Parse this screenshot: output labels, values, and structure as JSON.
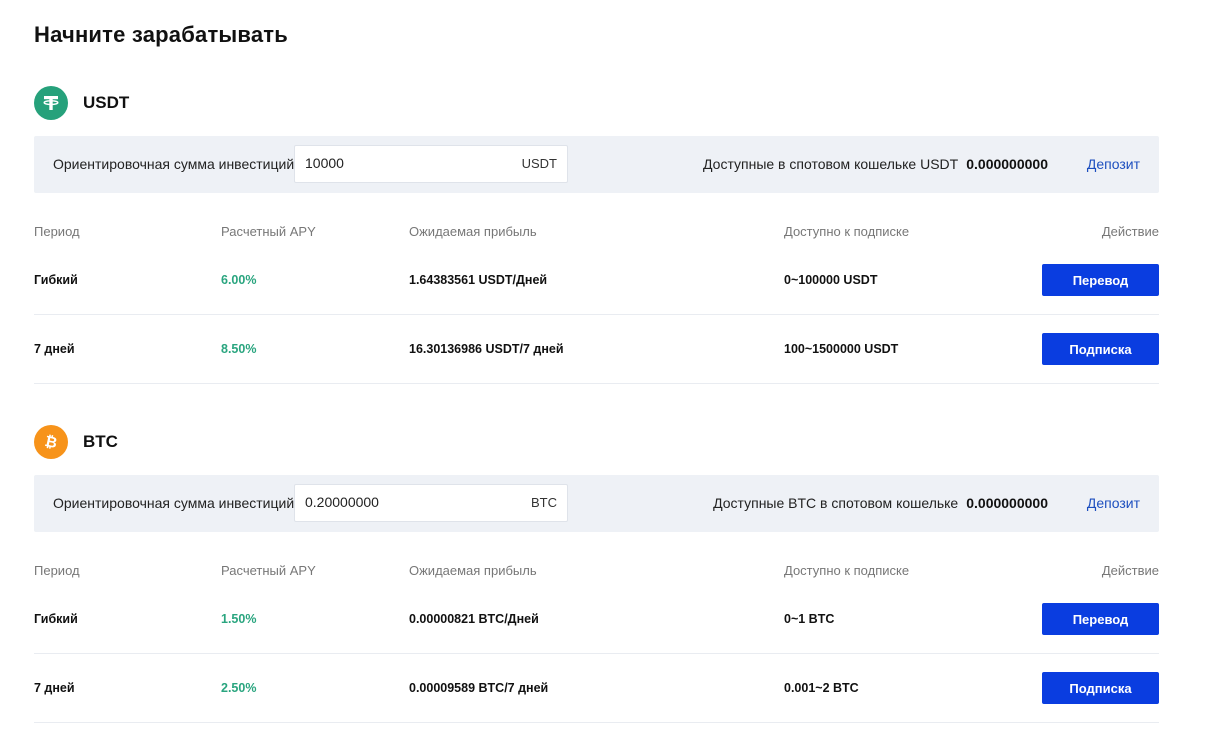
{
  "page": {
    "title": "Начните зарабатывать"
  },
  "columns": {
    "period": "Период",
    "apy": "Расчетный APY",
    "profit": "Ожидаемая прибыль",
    "available": "Доступно к подписке",
    "action": "Действие"
  },
  "invest_label": "Ориентировочная сумма инвестиций",
  "deposit_label": "Депозит",
  "sections": [
    {
      "coin": "USDT",
      "icon": "tether-icon",
      "icon_color": "#26a17b",
      "amount_value": "10000",
      "amount_unit": "USDT",
      "available_label": "Доступные в спотовом кошельке USDT",
      "balance": "0.000000000",
      "rows": [
        {
          "period": "Гибкий",
          "apy": "6.00%",
          "profit": "1.64383561 USDT/Дней",
          "available": "0~100000 USDT",
          "action": "Перевод"
        },
        {
          "period": "7 дней",
          "apy": "8.50%",
          "profit": "16.30136986 USDT/7 дней",
          "available": "100~1500000 USDT",
          "action": "Подписка"
        }
      ]
    },
    {
      "coin": "BTC",
      "icon": "bitcoin-icon",
      "icon_color": "#f7931a",
      "amount_value": "0.20000000",
      "amount_unit": "BTC",
      "available_label": "Доступные BTC в спотовом кошельке",
      "balance": "0.000000000",
      "rows": [
        {
          "period": "Гибкий",
          "apy": "1.50%",
          "profit": "0.00000821 BTC/Дней",
          "available": "0~1 BTC",
          "action": "Перевод"
        },
        {
          "period": "7 дней",
          "apy": "2.50%",
          "profit": "0.00009589 BTC/7 дней",
          "available": "0.001~2 BTC",
          "action": "Подписка"
        }
      ]
    }
  ],
  "colors": {
    "accent": "#0a3de0",
    "apy": "#2aa57f",
    "link": "#1d4fbf",
    "bar_bg": "#eef1f6"
  }
}
